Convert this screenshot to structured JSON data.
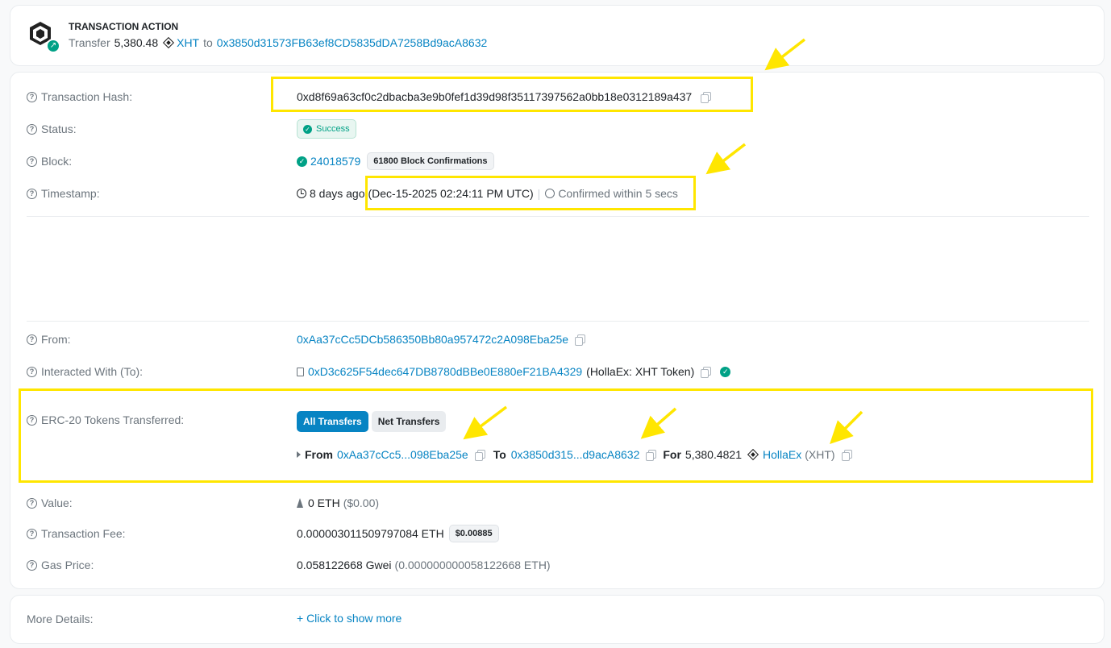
{
  "action": {
    "title": "TRANSACTION ACTION",
    "verb": "Transfer",
    "amount": "5,380.48",
    "token": "XHT",
    "to_word": "to",
    "to_address": "0x3850d31573FB63ef8CD5835dDA7258Bd9acA8632"
  },
  "details": {
    "hash_label": "Transaction Hash:",
    "hash_value": "0xd8f69a63cf0c2dbacba3e9b0fef1d39d98f35117397562a0bb18e0312189a437",
    "status_label": "Status:",
    "status_value": "Success",
    "block_label": "Block:",
    "block_value": "24018579",
    "block_confirmations": "61800 Block Confirmations",
    "timestamp_label": "Timestamp:",
    "timestamp_ago": "8 days ago",
    "timestamp_date": "(Dec-15-2025 02:24:11 PM UTC)",
    "timestamp_sep": "|",
    "timestamp_confirmed": "Confirmed within 5 secs",
    "from_label": "From:",
    "from_value": "0xAa37cCc5DCb586350Bb80a957472c2A098Eba25e",
    "to_label": "Interacted With (To):",
    "to_value": "0xD3c625F54dec647DB8780dBBe0E880eF21BA4329",
    "to_name": "(HollaEx: XHT Token)",
    "erc20_label": "ERC-20 Tokens Transferred:",
    "tab_all": "All Transfers",
    "tab_net": "Net Transfers",
    "transfer": {
      "from_word": "From",
      "from_addr": "0xAa37cCc5...098Eba25e",
      "to_word": "To",
      "to_addr": "0x3850d315...d9acA8632",
      "for_word": "For",
      "amount": "5,380.4821",
      "token_name": "HollaEx",
      "token_symbol": "(XHT)"
    },
    "value_label": "Value:",
    "value_eth": "0 ETH",
    "value_usd": "($0.00)",
    "fee_label": "Transaction Fee:",
    "fee_value": "0.000003011509797084 ETH",
    "fee_usd": "$0.00885",
    "gas_label": "Gas Price:",
    "gas_value": "0.058122668 Gwei",
    "gas_eth": "(0.000000000058122668 ETH)"
  },
  "more": {
    "label": "More Details:",
    "link": "+ Click to show more"
  },
  "colors": {
    "link": "#0784c3",
    "success": "#00a186",
    "highlight": "#ffe600"
  }
}
